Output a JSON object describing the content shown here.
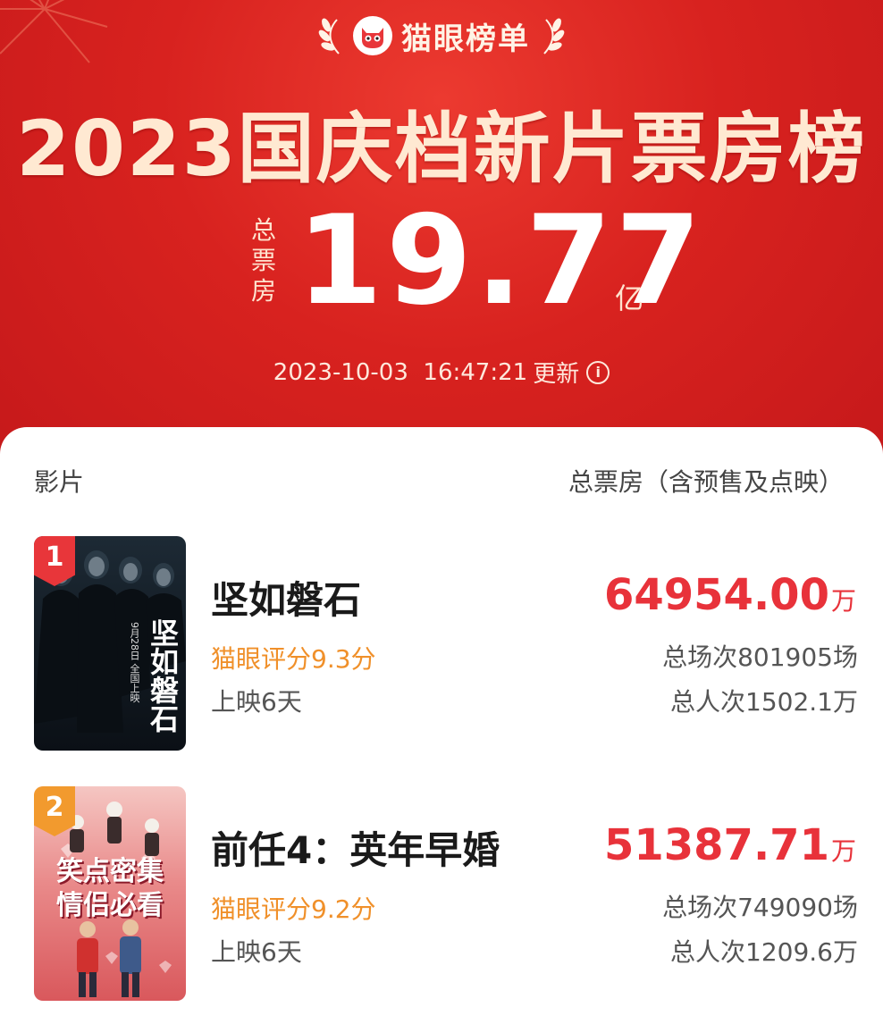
{
  "header": {
    "brand": "猫眼榜单",
    "title": "2023国庆档新片票房榜",
    "total_label": "总\n票\n房",
    "total_value": "19.77",
    "total_unit": "亿",
    "update_time": "2023-10-03  16:47:21",
    "update_label": "更新",
    "info_icon": "i"
  },
  "table": {
    "col_film": "影片",
    "col_gross": "总票房（含预售及点映）"
  },
  "movies": [
    {
      "rank": "1",
      "name": "坚如磐石",
      "score": "猫眼评分9.3分",
      "days": "上映6天",
      "gross": "64954.00",
      "gross_unit": "万",
      "shows": "总场次801905场",
      "viewers": "总人次1502.1万",
      "poster_title": "坚如磐石",
      "poster_date": "9月28日 全国上映"
    },
    {
      "rank": "2",
      "name": "前任4：英年早婚",
      "score": "猫眼评分9.2分",
      "days": "上映6天",
      "gross": "51387.71",
      "gross_unit": "万",
      "shows": "总场次749090场",
      "viewers": "总人次1209.6万",
      "poster_line1": "笑点密集",
      "poster_line2": "情侣必看"
    }
  ],
  "colors": {
    "hero_red": "#d8221f",
    "gross_red": "#e8323a",
    "score_orange": "#f0902a",
    "rank1": "#e8363a",
    "rank2": "#f29a2e"
  }
}
